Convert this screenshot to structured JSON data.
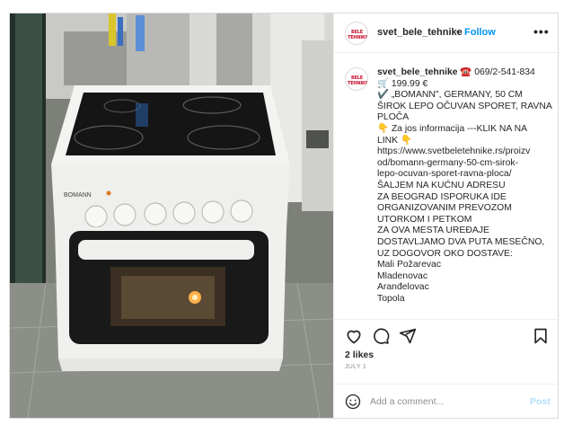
{
  "account": {
    "username": "svet_bele_tehnike",
    "avatar_text": "BELE TEHNIKE",
    "follow_label": "Follow",
    "separator": "•"
  },
  "caption": {
    "username": "svet_bele_tehnike",
    "lines": [
      " ☎️ 069/2-541-834",
      "🛒 199.99 €",
      "✔️ „BOMANN\", GERMANY, 50 CM",
      "ŠIROK LEPO OČUVAN SPORET, RAVNA",
      "PLOČA",
      "👇 Za jos informacija ---KLIK NA NA",
      "LINK 👇",
      "https://www.svetbeletehnike.rs/proizv",
      "od/bomann-germany-50-cm-sirok-",
      "lepo-ocuvan-sporet-ravna-ploca/",
      "ŠALJEM NA KUĆNU ADRESU",
      "ZA BEOGRAD ISPORUKA IDE",
      "ORGANIZOVANIM PREVOZOM",
      "UTORKOM I PETKOM",
      "ZA OVA MESTA UREĐAJE",
      "DOSTAVLJAMO DVA PUTA MESEČNO,",
      "UZ DOGOVOR OKO DOSTAVE:",
      "Mali Požarevac",
      "Mladenovac",
      "Aranđelovac",
      "Topola"
    ]
  },
  "photo": {
    "stove_brand": "BOMANN"
  },
  "engagement": {
    "likes": "2 likes",
    "date": "JULY 1"
  },
  "comment_box": {
    "placeholder": "Add a comment...",
    "post_label": "Post"
  },
  "colors": {
    "link_blue": "#0095f6",
    "post_disabled": "#b2dffc",
    "muted": "#8e8e8e",
    "border": "#dbdbdb",
    "text": "#262626"
  },
  "icons": [
    "heart-icon",
    "comment-icon",
    "share-icon",
    "bookmark-icon",
    "emoji-icon",
    "more-icon"
  ]
}
